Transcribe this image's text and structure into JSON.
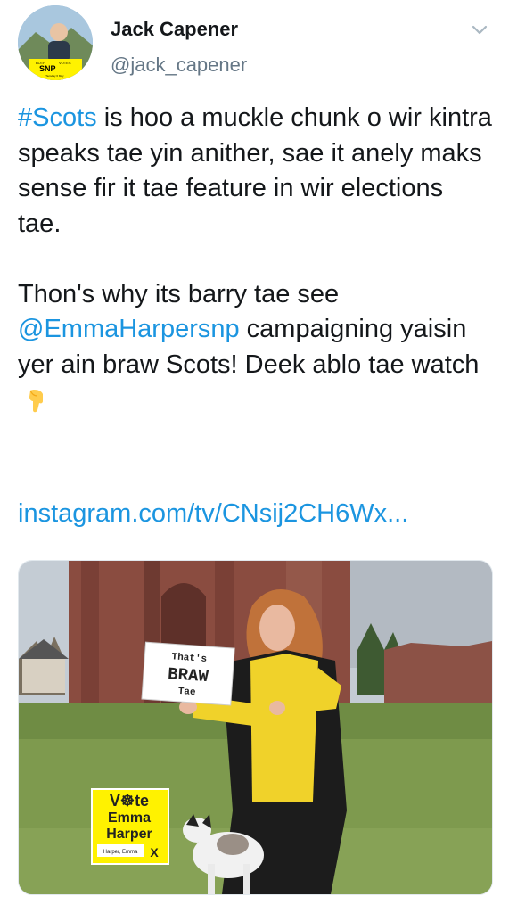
{
  "author": {
    "name": "Jack Capener",
    "handle": "@jack_capener",
    "avatar_badge": "SNP",
    "avatar_badge_line1": "BOTH",
    "avatar_badge_line2": "VOTES",
    "avatar_badge_sub": "Thursday 6 May"
  },
  "tweet": {
    "hashtag": "#Scots",
    "para1_rest": " is hoo a muckle chunk o wir kintra speaks tae yin anither, sae it anely maks sense fir it tae feature in wir elections tae.",
    "para2_start": "Thon's why its barry tae see ",
    "mention": "@EmmaHarpersnp",
    "para2_rest": " campaigning yaisin yer ain braw Scots! Deek ablo tae watch",
    "emoji": "backhand-index-pointing-down",
    "link": "instagram.com/tv/CNsij2CH6Wx..."
  },
  "media": {
    "sign_line1": "That's",
    "sign_line2": "BRAW",
    "sign_line3": "Tae",
    "poster_line1": "V☸te",
    "poster_line2": "Emma",
    "poster_line3": "Harper",
    "poster_small": "Harper, Emma",
    "poster_mark": "X"
  },
  "colors": {
    "link": "#1b95e0",
    "text": "#14171a",
    "secondary": "#657786",
    "snp_yellow": "#fff200"
  }
}
